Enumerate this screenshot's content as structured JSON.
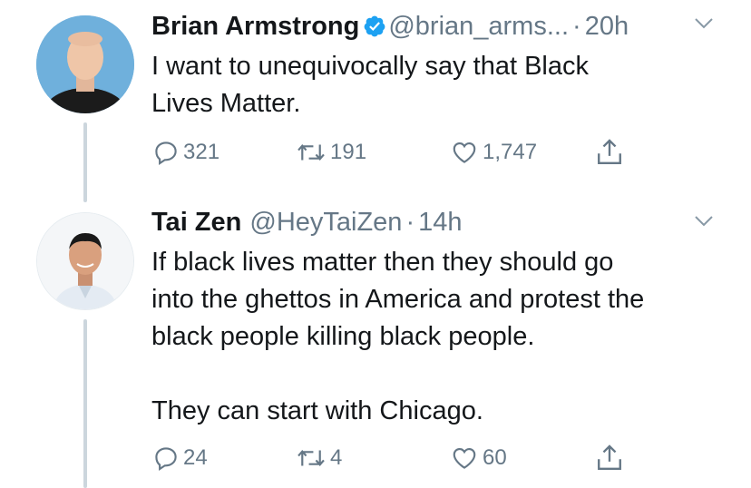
{
  "tweets": [
    {
      "name": "Brian Armstrong",
      "handle": "@brian_arms...",
      "sep": "·",
      "time": "20h",
      "verified": true,
      "text": "I want to unequivocally say that Black\nLives Matter.",
      "replies": "321",
      "retweets": "191",
      "likes": "1,747"
    },
    {
      "name": "Tai Zen",
      "handle": "@HeyTaiZen",
      "sep": "·",
      "time": "14h",
      "verified": false,
      "text": "If black lives matter then they should go\ninto the ghettos in America and protest the\nblack people killing black people.\n\nThey can start with Chicago.",
      "replies": "24",
      "retweets": "4",
      "likes": "60"
    }
  ],
  "colors": {
    "text": "#14171a",
    "muted": "#657786",
    "verified": "#1da1f2",
    "thread_line": "#ccd6dd"
  },
  "icons": [
    "verified-badge-icon",
    "chevron-down-icon",
    "reply-icon",
    "retweet-icon",
    "like-icon",
    "share-icon"
  ]
}
